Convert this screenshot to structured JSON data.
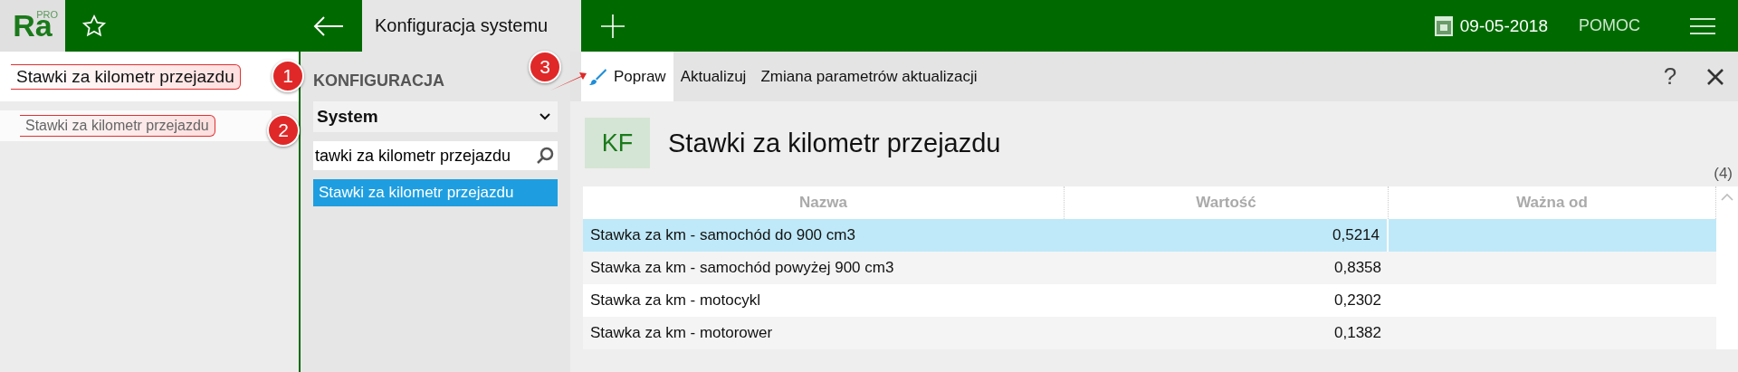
{
  "app_bar": {
    "logo": "Ra",
    "logo_badge": "PRO",
    "tab": {
      "label": "Konfiguracja systemu",
      "selected": true
    },
    "date": "09-05-2018",
    "help": "POMOC"
  },
  "left_panel": {
    "search": {
      "value": "Stawki za kilometr przejazdu"
    },
    "results": [
      {
        "label": "Stawki za kilometr przejazdu",
        "selected": true
      }
    ]
  },
  "middle_panel": {
    "title": "KONFIGURACJA",
    "select": {
      "value": "System"
    },
    "search": {
      "value": "tawki za kilometr przejazdu"
    },
    "items": [
      {
        "label": "Stawki za kilometr przejazdu",
        "selected": true
      }
    ]
  },
  "toolbar": {
    "buttons": [
      {
        "label": "Popraw",
        "selected": true
      },
      {
        "label": "Aktualizuj",
        "selected": false
      },
      {
        "label": "Zmiana parametrów aktualizacji",
        "selected": false
      }
    ],
    "help": "?"
  },
  "header": {
    "badge": "KF",
    "title": "Stawki za kilometr przejazdu",
    "count": "(4)"
  },
  "table": {
    "columns": [
      "Nazwa",
      "Wartość",
      "Ważna od"
    ],
    "rows": [
      {
        "cells": [
          "Stawka za km - samochód do 900 cm3",
          "0,5214",
          ""
        ],
        "selected": true
      },
      {
        "cells": [
          "Stawka za km - samochód powyżej 900 cm3",
          "0,8358",
          ""
        ],
        "selected": false
      },
      {
        "cells": [
          "Stawka za km - motocykl",
          "0,2302",
          ""
        ],
        "selected": false
      },
      {
        "cells": [
          "Stawka za km - motorower",
          "0,1382",
          ""
        ],
        "selected": false
      }
    ]
  },
  "callouts": [
    "1",
    "2",
    "3"
  ]
}
